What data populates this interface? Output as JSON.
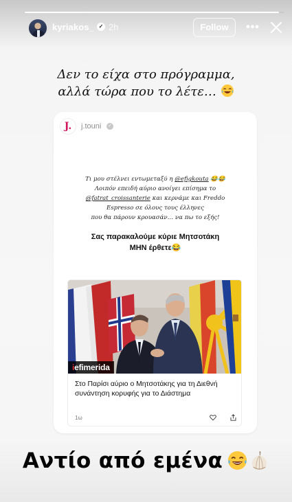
{
  "story": {
    "progress": 0.98,
    "header": {
      "username": "kyriakos_",
      "time": "2h",
      "follow_label": "Follow",
      "more_label": "•••"
    },
    "caption": {
      "line1": "Δεν το είχα στο πρόγραμμα,",
      "line2": "αλλά τώρα που το λέτε…"
    },
    "reshared_post": {
      "avatar_letter": "J.",
      "username": "j.touni",
      "body": {
        "l1_a": "Τι μου στέλνει εντωμεταξύ η ",
        "l1_mention": "@efigkouta",
        "l1_b": " 😂😂",
        "l2": "Λοιπόν επειδή αύριο ανοίγει επίσημα το",
        "l3_mention": "@fatrat_croissanterie",
        "l3_b": " και κερνάμε και Freddo",
        "l4": "Espresso σε όλους τους έλληνες",
        "l5": "που θα πάρουν κρουασάν… να πω το εξής!"
      },
      "bold": {
        "line1": "Σας παρακαλούμε κύριε Μητσοτάκη",
        "line2": "ΜΗΝ έρθετε😂"
      },
      "news_card": {
        "brand_prefix": "i",
        "brand_rest": "efimerida",
        "title": "Στο Παρίσι αύριο ο Μητσοτάκης για τη Διεθνή συνάντηση κορυφής για το Διάστημα",
        "time": "1ω"
      }
    },
    "footer_text": "Αντίο από εμένα"
  }
}
